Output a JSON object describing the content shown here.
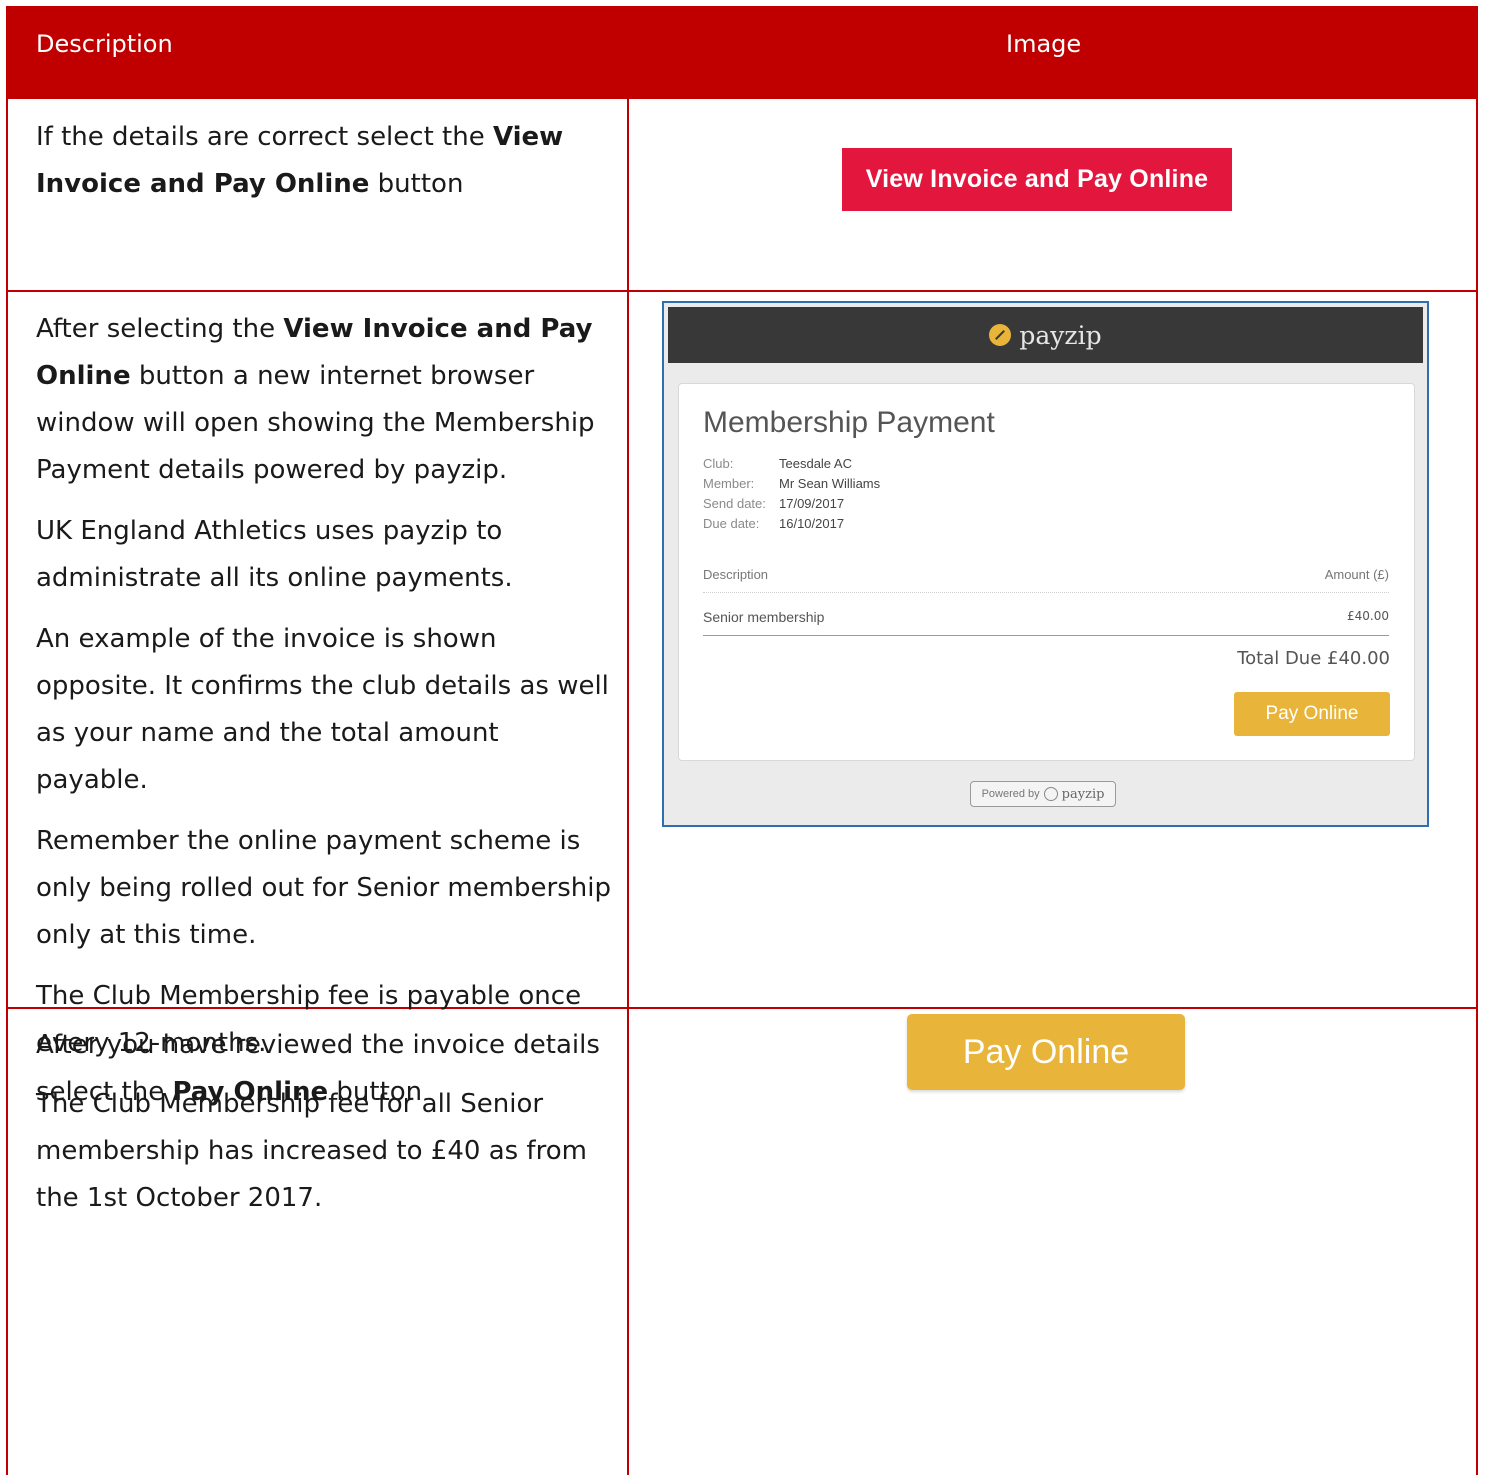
{
  "table": {
    "header": {
      "description": "Description",
      "image": "Image"
    },
    "row1": {
      "text_before": "If the details are correct select the ",
      "bold": "View Invoice and Pay Online",
      "text_after": " button",
      "button_label": "View Invoice and Pay Online"
    },
    "row2": {
      "p1_before": "After selecting the ",
      "p1_bold": "View Invoice and Pay Online",
      "p1_after": " button a new internet browser window will open showing the Membership Payment details powered by payzip.",
      "p2": "UK England Athletics uses payzip to administrate all its online payments.",
      "p3": "An example of the invoice is shown opposite. It confirms the club details as well as your name and the total amount payable.",
      "p4": "Remember the online payment scheme is only being rolled out for Senior membership only at this time.",
      "p5": "The Club Membership fee is payable once every 12-months.",
      "p6": "The Club Membership fee for all Senior membership has increased to £40 as from the 1st October 2017."
    },
    "row3": {
      "text_before": "After you have reviewed the invoice details select the ",
      "bold": "Pay Online",
      "text_after": " button",
      "button_label": "Pay Online"
    }
  },
  "invoice": {
    "brand": "payzip",
    "title": "Membership Payment",
    "meta": [
      {
        "label": "Club:",
        "value": "Teesdale AC"
      },
      {
        "label": "Member:",
        "value": "Mr Sean Williams"
      },
      {
        "label": "Send date:",
        "value": "17/09/2017"
      },
      {
        "label": "Due date:",
        "value": "16/10/2017"
      }
    ],
    "col_description": "Description",
    "col_amount": "Amount (£)",
    "line_item": "Senior membership",
    "line_amount": "£40.00",
    "total": "Total Due £40.00",
    "pay_button": "Pay Online",
    "powered_by": "Powered by",
    "powered_brand": "payzip"
  },
  "colors": {
    "header_bg": "#c00000",
    "red_button": "#e3173e",
    "gold_button": "#e8b53a",
    "payzip_bar": "#383838"
  }
}
